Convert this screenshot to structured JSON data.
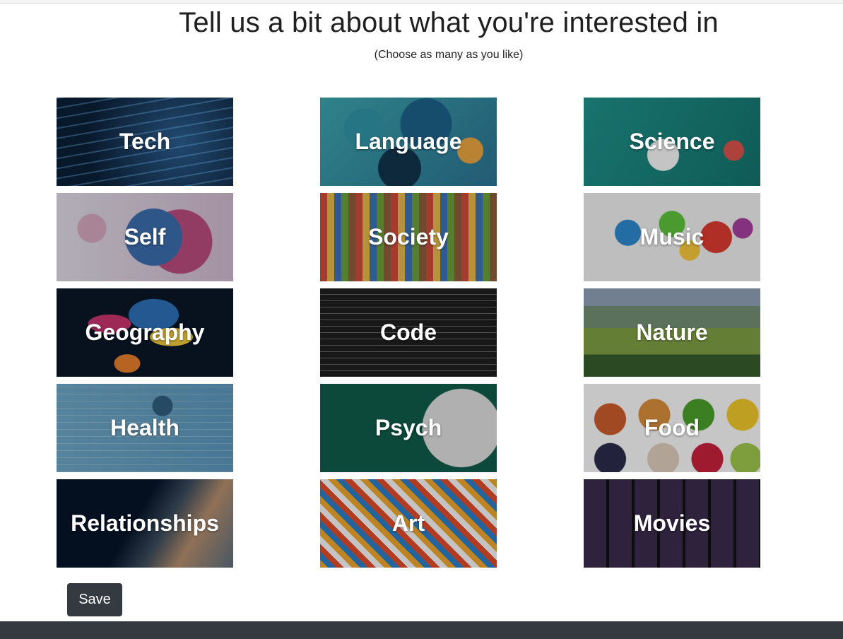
{
  "header": {
    "title": "Tell us a bit about what you're interested in",
    "subtitle": "(Choose as many as you like)"
  },
  "tiles": [
    {
      "label": "Tech"
    },
    {
      "label": "Language"
    },
    {
      "label": "Science"
    },
    {
      "label": "Self"
    },
    {
      "label": "Society"
    },
    {
      "label": "Music"
    },
    {
      "label": "Geography"
    },
    {
      "label": "Code"
    },
    {
      "label": "Nature"
    },
    {
      "label": "Health"
    },
    {
      "label": "Psych"
    },
    {
      "label": "Food"
    },
    {
      "label": "Relationships"
    },
    {
      "label": "Art"
    },
    {
      "label": "Movies"
    }
  ],
  "actions": {
    "save_label": "Save"
  },
  "colors": {
    "button_bg": "#343a40",
    "footer_bg": "#343a40"
  }
}
